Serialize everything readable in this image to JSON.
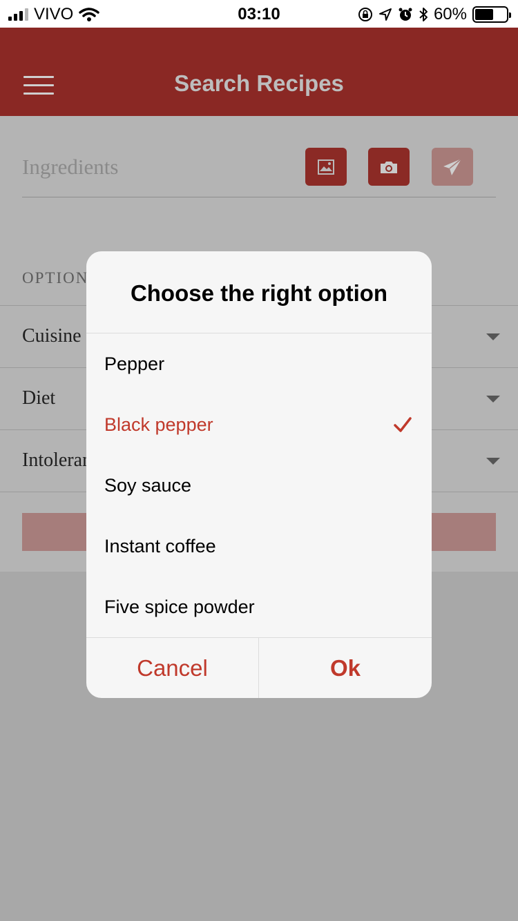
{
  "status_bar": {
    "carrier": "VIVO",
    "time": "03:10",
    "battery_percent": "60%",
    "battery_level": 0.6,
    "signal_bars_active": 3,
    "signal_bars_total": 4
  },
  "header": {
    "title": "Search Recipes",
    "menu_icon": "hamburger-menu-icon",
    "background_color": "#8a2824"
  },
  "search": {
    "placeholder": "Ingredients",
    "buttons": [
      "image-icon",
      "camera-icon",
      "send-icon"
    ]
  },
  "options": {
    "section_label": "OPTION",
    "rows": [
      {
        "label": "Cuisine"
      },
      {
        "label": "Diet"
      },
      {
        "label": "Intoleran"
      }
    ]
  },
  "dialog": {
    "title": "Choose the right option",
    "items": [
      {
        "label": "Pepper",
        "selected": false
      },
      {
        "label": "Black pepper",
        "selected": true
      },
      {
        "label": "Soy sauce",
        "selected": false
      },
      {
        "label": "Instant coffee",
        "selected": false
      },
      {
        "label": "Five spice powder",
        "selected": false
      }
    ],
    "cancel_label": "Cancel",
    "ok_label": "Ok",
    "accent_color": "#c0392b"
  }
}
